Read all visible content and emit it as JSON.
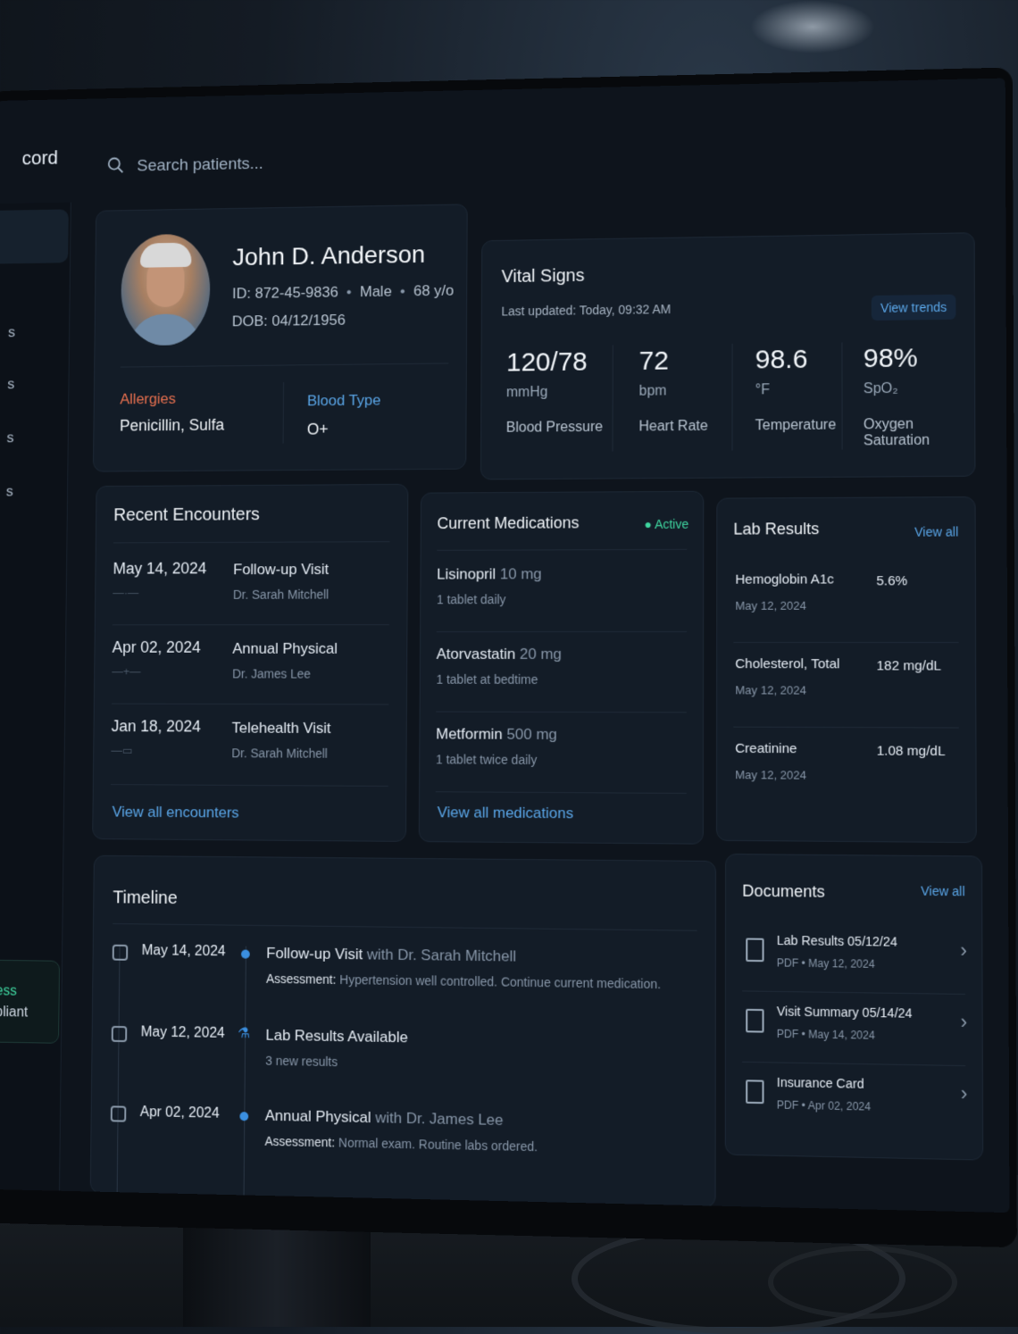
{
  "app": {
    "title_fragment": "cord"
  },
  "search": {
    "placeholder": "Search patients..."
  },
  "sidebar": {
    "letters": [
      "s",
      "s",
      "s",
      "s"
    ],
    "hipaa_line1": "ess",
    "hipaa_line2": "pliant"
  },
  "patient": {
    "name": "John D. Anderson",
    "id": "ID: 872-45-9836",
    "sex": "Male",
    "age": "68 y/o",
    "dob": "DOB: 04/12/1956",
    "allergies_label": "Allergies",
    "allergies": "Penicillin, Sulfa",
    "blood_type_label": "Blood Type",
    "blood_type": "O+"
  },
  "vitals": {
    "title": "Vital Signs",
    "updated": "Last updated: Today, 09:32 AM",
    "view_trends": "View trends",
    "items": [
      {
        "value": "120/78",
        "unit": "mmHg",
        "label": "Blood Pressure"
      },
      {
        "value": "72",
        "unit": "bpm",
        "label": "Heart Rate"
      },
      {
        "value": "98.6",
        "unit": "°F",
        "label": "Temperature"
      },
      {
        "value": "98%",
        "unit": "SpO₂",
        "label": "Oxygen Saturation"
      }
    ]
  },
  "encounters": {
    "title": "Recent Encounters",
    "rows": [
      {
        "date": "May 14, 2024",
        "type": "Follow-up Visit",
        "doctor": "Dr. Sarah Mitchell"
      },
      {
        "date": "Apr 02, 2024",
        "type": "Annual Physical",
        "doctor": "Dr. James Lee"
      },
      {
        "date": "Jan 18, 2024",
        "type": "Telehealth Visit",
        "doctor": "Dr. Sarah Mitchell"
      }
    ],
    "view_all": "View all encounters"
  },
  "medications": {
    "title": "Current Medications",
    "status": "Active",
    "rows": [
      {
        "name": "Lisinopril",
        "dose": "10 mg",
        "instructions": "1 tablet daily"
      },
      {
        "name": "Atorvastatin",
        "dose": "20 mg",
        "instructions": "1 tablet at bedtime"
      },
      {
        "name": "Metformin",
        "dose": "500 mg",
        "instructions": "1 tablet twice daily"
      }
    ],
    "view_all": "View all medications"
  },
  "labs": {
    "title": "Lab Results",
    "view_all": "View all",
    "rows": [
      {
        "name": "Hemoglobin A1c",
        "date": "May 12, 2024",
        "value": "5.6%"
      },
      {
        "name": "Cholesterol, Total",
        "date": "May 12, 2024",
        "value": "182 mg/dL"
      },
      {
        "name": "Creatinine",
        "date": "May 12, 2024",
        "value": "1.08 mg/dL"
      }
    ]
  },
  "timeline": {
    "title": "Timeline",
    "items": [
      {
        "date": "May 14, 2024",
        "title": "Follow-up Visit",
        "with": "with Dr. Sarah Mitchell",
        "label": "Assessment:",
        "detail": "Hypertension well controlled. Continue current medication."
      },
      {
        "date": "May 12, 2024",
        "title": "Lab Results Available",
        "with": "",
        "label": "",
        "detail": "3 new results"
      },
      {
        "date": "Apr 02, 2024",
        "title": "Annual Physical",
        "with": "with Dr. James Lee",
        "label": "Assessment:",
        "detail": "Normal exam. Routine labs ordered."
      }
    ]
  },
  "documents": {
    "title": "Documents",
    "view_all": "View all",
    "rows": [
      {
        "name": "Lab Results 05/12/24",
        "meta": "PDF • May 12, 2024"
      },
      {
        "name": "Visit Summary 05/14/24",
        "meta": "PDF • May 14, 2024"
      },
      {
        "name": "Insurance Card",
        "meta": "PDF • Apr 02, 2024"
      }
    ]
  }
}
